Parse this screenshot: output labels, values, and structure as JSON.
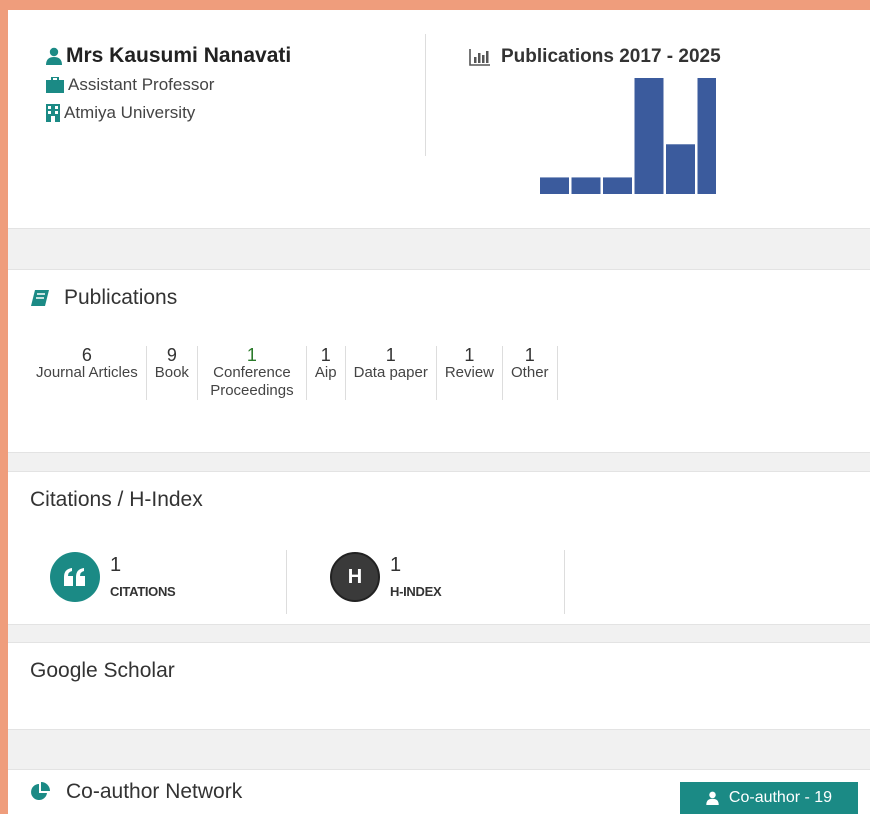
{
  "profile": {
    "name": "Mrs Kausumi Nanavati",
    "title": "Assistant Professor",
    "institution": "Atmiya University"
  },
  "chart_title": "Publications 2017 - 2025",
  "chart_data": {
    "type": "bar",
    "title": "Publications 2017 - 2025",
    "values": [
      1,
      1,
      1,
      7,
      3,
      7
    ],
    "color": "#3b5b9d"
  },
  "publications": {
    "heading": "Publications",
    "stats": [
      {
        "count": "6",
        "label": "Journal Articles"
      },
      {
        "count": "9",
        "label": "Book"
      },
      {
        "count": "1",
        "label": "Conference Proceedings"
      },
      {
        "count": "1",
        "label": "Aip"
      },
      {
        "count": "1",
        "label": "Data paper"
      },
      {
        "count": "1",
        "label": "Review"
      },
      {
        "count": "1",
        "label": "Other"
      }
    ]
  },
  "citations": {
    "heading": "Citations / H-Index",
    "citations_icon": "quote-icon",
    "citations_value": "1",
    "citations_label": "CITATIONS",
    "hindex_icon_text": "H",
    "hindex_value": "1",
    "hindex_label": "H-INDEX"
  },
  "google_scholar": {
    "heading": "Google Scholar"
  },
  "coauthor": {
    "heading": "Co-author Network",
    "button_label": "Co-author - 19"
  },
  "colors": {
    "accent": "#1b8a85",
    "bar": "#3b5b9d",
    "page_bg": "#ef9d7c",
    "hindex_circle": "#3a3a3a"
  }
}
